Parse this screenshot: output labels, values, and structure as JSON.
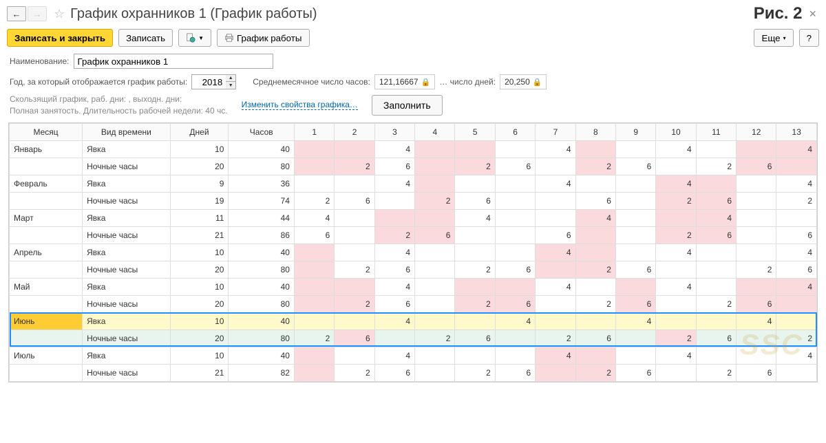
{
  "header": {
    "title": "График охранников 1 (График работы)",
    "figure_label": "Рис. 2"
  },
  "toolbar": {
    "save_close": "Записать и закрыть",
    "save": "Записать",
    "print": "График работы",
    "more": "Еще",
    "help": "?"
  },
  "form": {
    "name_label": "Наименование:",
    "name_value": "График охранников 1",
    "year_label": "Год, за который отображается график работы:",
    "year_value": "2018",
    "avg_hours_label": "Среднемесячное число часов:",
    "avg_hours_value": "121,16667",
    "avg_days_label": "… число дней:",
    "avg_days_value": "20,250",
    "desc_line1": "Скользящий график, раб. дни: , выходн. дни:",
    "desc_line2": "Полная занятость. Длительность рабочей недели: 40 чс.",
    "change_link": "Изменить свойства графика…",
    "fill_btn": "Заполнить"
  },
  "table": {
    "headers": {
      "month": "Месяц",
      "type": "Вид времени",
      "days": "Дней",
      "hours": "Часов",
      "d1": "1",
      "d2": "2",
      "d3": "3",
      "d4": "4",
      "d5": "5",
      "d6": "6",
      "d7": "7",
      "d8": "8",
      "d9": "9",
      "d10": "10",
      "d11": "11",
      "d12": "12",
      "d13": "13"
    },
    "rows": [
      {
        "month": "Январь",
        "type": "Явка",
        "days": "10",
        "hours": "40",
        "cells": [
          {
            "v": "",
            "c": "pink"
          },
          {
            "v": "",
            "c": "pink"
          },
          {
            "v": "4",
            "c": ""
          },
          {
            "v": "",
            "c": "pink"
          },
          {
            "v": "",
            "c": "pink"
          },
          {
            "v": "",
            "c": ""
          },
          {
            "v": "4",
            "c": ""
          },
          {
            "v": "",
            "c": "pink"
          },
          {
            "v": "",
            "c": ""
          },
          {
            "v": "4",
            "c": ""
          },
          {
            "v": "",
            "c": ""
          },
          {
            "v": "",
            "c": "pink"
          },
          {
            "v": "4",
            "c": "pink"
          }
        ]
      },
      {
        "month": "",
        "type": "Ночные часы",
        "days": "20",
        "hours": "80",
        "cells": [
          {
            "v": "",
            "c": "pink"
          },
          {
            "v": "2",
            "c": "pink"
          },
          {
            "v": "6",
            "c": ""
          },
          {
            "v": "",
            "c": "pink"
          },
          {
            "v": "2",
            "c": "pink"
          },
          {
            "v": "6",
            "c": ""
          },
          {
            "v": "",
            "c": ""
          },
          {
            "v": "2",
            "c": "pink"
          },
          {
            "v": "6",
            "c": ""
          },
          {
            "v": "",
            "c": ""
          },
          {
            "v": "2",
            "c": ""
          },
          {
            "v": "6",
            "c": "pink"
          },
          {
            "v": "",
            "c": "pink"
          }
        ]
      },
      {
        "month": "Февраль",
        "type": "Явка",
        "days": "9",
        "hours": "36",
        "cells": [
          {
            "v": "",
            "c": ""
          },
          {
            "v": "",
            "c": ""
          },
          {
            "v": "4",
            "c": ""
          },
          {
            "v": "",
            "c": "pink"
          },
          {
            "v": "",
            "c": ""
          },
          {
            "v": "",
            "c": ""
          },
          {
            "v": "4",
            "c": ""
          },
          {
            "v": "",
            "c": ""
          },
          {
            "v": "",
            "c": ""
          },
          {
            "v": "4",
            "c": "pink"
          },
          {
            "v": "",
            "c": "pink"
          },
          {
            "v": "",
            "c": ""
          },
          {
            "v": "4",
            "c": ""
          }
        ]
      },
      {
        "month": "",
        "type": "Ночные часы",
        "days": "19",
        "hours": "74",
        "cells": [
          {
            "v": "2",
            "c": ""
          },
          {
            "v": "6",
            "c": ""
          },
          {
            "v": "",
            "c": ""
          },
          {
            "v": "2",
            "c": "pink"
          },
          {
            "v": "6",
            "c": ""
          },
          {
            "v": "",
            "c": ""
          },
          {
            "v": "",
            "c": ""
          },
          {
            "v": "6",
            "c": ""
          },
          {
            "v": "",
            "c": ""
          },
          {
            "v": "2",
            "c": "pink"
          },
          {
            "v": "6",
            "c": "pink"
          },
          {
            "v": "",
            "c": ""
          },
          {
            "v": "2",
            "c": ""
          }
        ]
      },
      {
        "month": "Март",
        "type": "Явка",
        "days": "11",
        "hours": "44",
        "cells": [
          {
            "v": "4",
            "c": ""
          },
          {
            "v": "",
            "c": ""
          },
          {
            "v": "",
            "c": "pink"
          },
          {
            "v": "",
            "c": "pink"
          },
          {
            "v": "4",
            "c": ""
          },
          {
            "v": "",
            "c": ""
          },
          {
            "v": "",
            "c": ""
          },
          {
            "v": "4",
            "c": "pink"
          },
          {
            "v": "",
            "c": ""
          },
          {
            "v": "",
            "c": "pink"
          },
          {
            "v": "4",
            "c": "pink"
          },
          {
            "v": "",
            "c": ""
          },
          {
            "v": "",
            "c": ""
          }
        ]
      },
      {
        "month": "",
        "type": "Ночные часы",
        "days": "21",
        "hours": "86",
        "cells": [
          {
            "v": "6",
            "c": ""
          },
          {
            "v": "",
            "c": ""
          },
          {
            "v": "2",
            "c": "pink"
          },
          {
            "v": "6",
            "c": "pink"
          },
          {
            "v": "",
            "c": ""
          },
          {
            "v": "",
            "c": ""
          },
          {
            "v": "6",
            "c": ""
          },
          {
            "v": "",
            "c": "pink"
          },
          {
            "v": "",
            "c": ""
          },
          {
            "v": "2",
            "c": "pink"
          },
          {
            "v": "6",
            "c": "pink"
          },
          {
            "v": "",
            "c": ""
          },
          {
            "v": "6",
            "c": ""
          }
        ]
      },
      {
        "month": "Апрель",
        "type": "Явка",
        "days": "10",
        "hours": "40",
        "cells": [
          {
            "v": "",
            "c": "pink"
          },
          {
            "v": "",
            "c": ""
          },
          {
            "v": "4",
            "c": ""
          },
          {
            "v": "",
            "c": ""
          },
          {
            "v": "",
            "c": ""
          },
          {
            "v": "",
            "c": ""
          },
          {
            "v": "4",
            "c": "pink"
          },
          {
            "v": "",
            "c": "pink"
          },
          {
            "v": "",
            "c": ""
          },
          {
            "v": "4",
            "c": ""
          },
          {
            "v": "",
            "c": ""
          },
          {
            "v": "",
            "c": ""
          },
          {
            "v": "4",
            "c": ""
          }
        ]
      },
      {
        "month": "",
        "type": "Ночные часы",
        "days": "20",
        "hours": "80",
        "cells": [
          {
            "v": "",
            "c": "pink"
          },
          {
            "v": "2",
            "c": ""
          },
          {
            "v": "6",
            "c": ""
          },
          {
            "v": "",
            "c": ""
          },
          {
            "v": "2",
            "c": ""
          },
          {
            "v": "6",
            "c": ""
          },
          {
            "v": "",
            "c": "pink"
          },
          {
            "v": "2",
            "c": "pink"
          },
          {
            "v": "6",
            "c": ""
          },
          {
            "v": "",
            "c": ""
          },
          {
            "v": "",
            "c": ""
          },
          {
            "v": "2",
            "c": ""
          },
          {
            "v": "6",
            "c": ""
          }
        ]
      },
      {
        "month": "Май",
        "type": "Явка",
        "days": "10",
        "hours": "40",
        "cells": [
          {
            "v": "",
            "c": "pink"
          },
          {
            "v": "",
            "c": "pink"
          },
          {
            "v": "4",
            "c": ""
          },
          {
            "v": "",
            "c": ""
          },
          {
            "v": "",
            "c": "pink"
          },
          {
            "v": "",
            "c": "pink"
          },
          {
            "v": "4",
            "c": ""
          },
          {
            "v": "",
            "c": ""
          },
          {
            "v": "",
            "c": "pink"
          },
          {
            "v": "4",
            "c": ""
          },
          {
            "v": "",
            "c": ""
          },
          {
            "v": "",
            "c": "pink"
          },
          {
            "v": "4",
            "c": "pink"
          }
        ]
      },
      {
        "month": "",
        "type": "Ночные часы",
        "days": "20",
        "hours": "80",
        "cells": [
          {
            "v": "",
            "c": "pink"
          },
          {
            "v": "2",
            "c": "pink"
          },
          {
            "v": "6",
            "c": ""
          },
          {
            "v": "",
            "c": ""
          },
          {
            "v": "2",
            "c": "pink"
          },
          {
            "v": "6",
            "c": "pink"
          },
          {
            "v": "",
            "c": ""
          },
          {
            "v": "2",
            "c": ""
          },
          {
            "v": "6",
            "c": "pink"
          },
          {
            "v": "",
            "c": ""
          },
          {
            "v": "2",
            "c": ""
          },
          {
            "v": "6",
            "c": "pink"
          },
          {
            "v": "",
            "c": "pink"
          }
        ]
      },
      {
        "month": "Июнь",
        "type": "Явка",
        "days": "10",
        "hours": "40",
        "cells": [
          {
            "v": "",
            "c": "yellow-row"
          },
          {
            "v": "",
            "c": "yellow-row"
          },
          {
            "v": "4",
            "c": "yellow-row"
          },
          {
            "v": "",
            "c": "yellow-row"
          },
          {
            "v": "",
            "c": "yellow-row"
          },
          {
            "v": "4",
            "c": "yellow-row"
          },
          {
            "v": "",
            "c": "yellow-row"
          },
          {
            "v": "",
            "c": "yellow-row"
          },
          {
            "v": "4",
            "c": "yellow-row"
          },
          {
            "v": "",
            "c": "yellow-row"
          },
          {
            "v": "",
            "c": "yellow-row"
          },
          {
            "v": "4",
            "c": "yellow-row"
          },
          {
            "v": "",
            "c": "yellow-row"
          }
        ],
        "sel": "month"
      },
      {
        "month": "",
        "type": "Ночные часы",
        "days": "20",
        "hours": "80",
        "cells": [
          {
            "v": "2",
            "c": "mint"
          },
          {
            "v": "6",
            "c": "pink"
          },
          {
            "v": "",
            "c": "mint"
          },
          {
            "v": "2",
            "c": "mint"
          },
          {
            "v": "6",
            "c": "mint"
          },
          {
            "v": "",
            "c": "mint"
          },
          {
            "v": "2",
            "c": "mint"
          },
          {
            "v": "6",
            "c": "mint"
          },
          {
            "v": "",
            "c": "mint"
          },
          {
            "v": "2",
            "c": "pink"
          },
          {
            "v": "6",
            "c": "mint"
          },
          {
            "v": "",
            "c": "mint"
          },
          {
            "v": "2",
            "c": "mint"
          }
        ],
        "leftc": "mint"
      },
      {
        "month": "Июль",
        "type": "Явка",
        "days": "10",
        "hours": "40",
        "cells": [
          {
            "v": "",
            "c": "pink"
          },
          {
            "v": "",
            "c": ""
          },
          {
            "v": "4",
            "c": ""
          },
          {
            "v": "",
            "c": ""
          },
          {
            "v": "",
            "c": ""
          },
          {
            "v": "",
            "c": ""
          },
          {
            "v": "4",
            "c": "pink"
          },
          {
            "v": "",
            "c": "pink"
          },
          {
            "v": "",
            "c": ""
          },
          {
            "v": "4",
            "c": ""
          },
          {
            "v": "",
            "c": ""
          },
          {
            "v": "",
            "c": ""
          },
          {
            "v": "4",
            "c": ""
          }
        ]
      },
      {
        "month": "",
        "type": "Ночные часы",
        "days": "21",
        "hours": "82",
        "cells": [
          {
            "v": "",
            "c": "pink"
          },
          {
            "v": "2",
            "c": ""
          },
          {
            "v": "6",
            "c": ""
          },
          {
            "v": "",
            "c": ""
          },
          {
            "v": "2",
            "c": ""
          },
          {
            "v": "6",
            "c": ""
          },
          {
            "v": "",
            "c": "pink"
          },
          {
            "v": "2",
            "c": "pink"
          },
          {
            "v": "6",
            "c": ""
          },
          {
            "v": "",
            "c": ""
          },
          {
            "v": "2",
            "c": ""
          },
          {
            "v": "6",
            "c": ""
          },
          {
            "v": "",
            "c": ""
          }
        ]
      }
    ]
  }
}
